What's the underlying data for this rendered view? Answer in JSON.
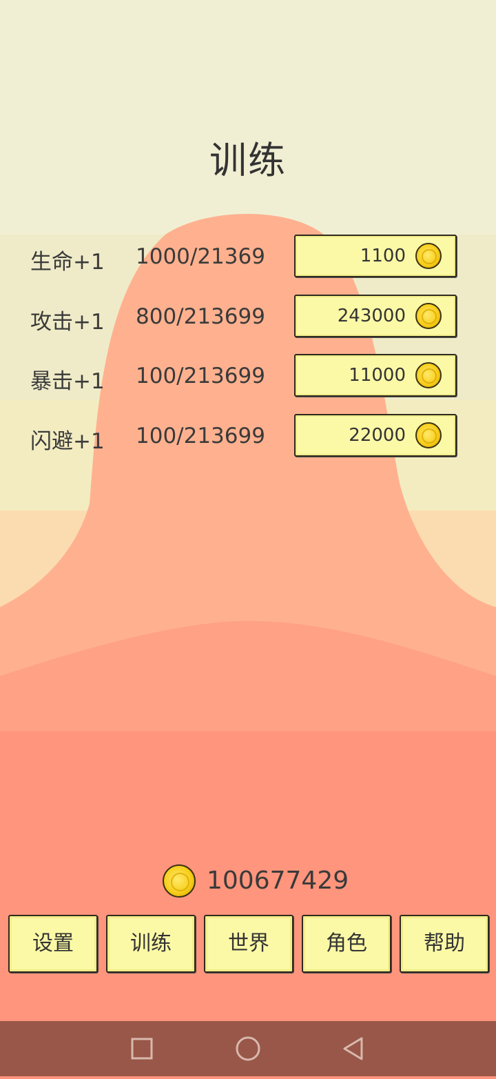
{
  "screen": {
    "title": "训练"
  },
  "training": [
    {
      "label": "生命+1",
      "progress": "1000/21369",
      "cost": "1100"
    },
    {
      "label": "攻击+1",
      "progress": "800/213699",
      "cost": "243000"
    },
    {
      "label": "暴击+1",
      "progress": "100/213699",
      "cost": "11000"
    },
    {
      "label": "闪避+1",
      "progress": "100/213699",
      "cost": "22000"
    }
  ],
  "wallet": {
    "coins": "100677429",
    "icon": "coin-icon"
  },
  "nav": [
    {
      "label": "设置"
    },
    {
      "label": "训练"
    },
    {
      "label": "世界"
    },
    {
      "label": "角色"
    },
    {
      "label": "帮助"
    }
  ],
  "system_nav": {
    "recent": "square-icon",
    "home": "circle-icon",
    "back": "triangle-back-icon"
  },
  "colors": {
    "sky_top": "#f1efd3",
    "mountain": "#ffb08f",
    "ground": "#ff957c",
    "button": "#fbf9a6",
    "system_bar": "#985748"
  }
}
